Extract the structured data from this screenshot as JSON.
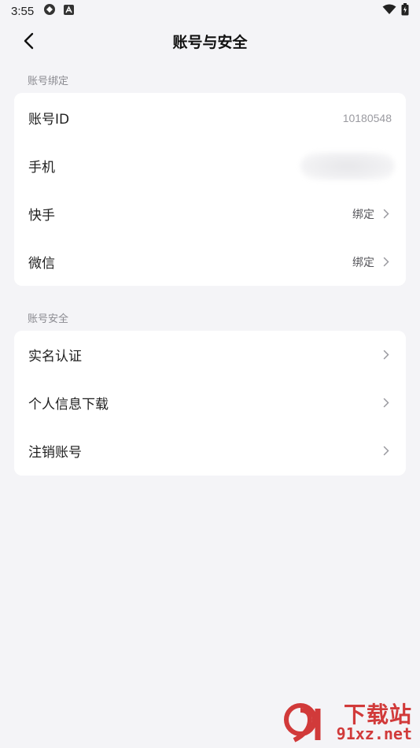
{
  "status_bar": {
    "time": "3:55"
  },
  "header": {
    "title": "账号与安全"
  },
  "binding_section": {
    "label": "账号绑定",
    "rows": [
      {
        "label": "账号ID",
        "value": "10180548"
      },
      {
        "label": "手机",
        "value": ""
      },
      {
        "label": "快手",
        "value": "绑定"
      },
      {
        "label": "微信",
        "value": "绑定"
      }
    ]
  },
  "security_section": {
    "label": "账号安全",
    "rows": [
      {
        "label": "实名认证"
      },
      {
        "label": "个人信息下载"
      },
      {
        "label": "注销账号"
      }
    ]
  },
  "watermark": {
    "cn": "下载站",
    "en": "91xz.net"
  },
  "colors": {
    "background": "#f4f4f7",
    "card": "#ffffff",
    "watermark": "#d13a3a"
  }
}
